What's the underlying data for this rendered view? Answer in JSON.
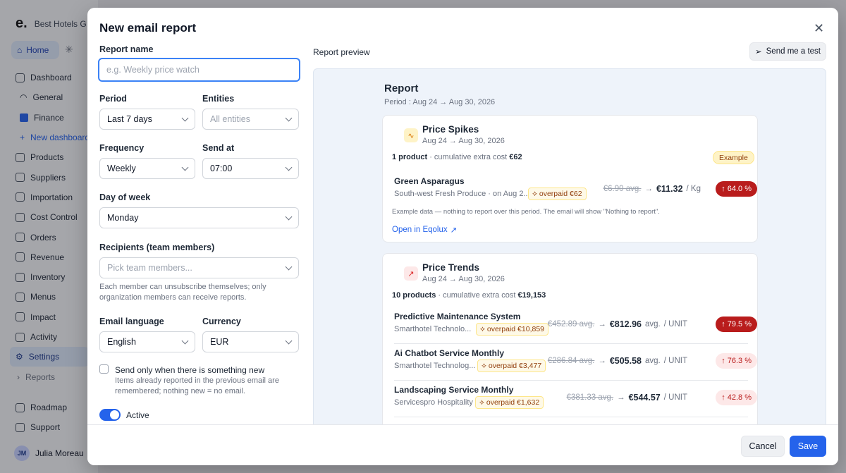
{
  "app": {
    "brand_logo": "e.",
    "brand_name": "Best Hotels G",
    "home_label": "Home",
    "nav": [
      {
        "label": "Dashboard"
      },
      {
        "label": "General"
      },
      {
        "label": "Finance"
      },
      {
        "label": "New dashboard"
      },
      {
        "label": "Products"
      },
      {
        "label": "Suppliers"
      },
      {
        "label": "Importation"
      },
      {
        "label": "Cost Control"
      },
      {
        "label": "Orders"
      },
      {
        "label": "Revenue"
      },
      {
        "label": "Inventory"
      },
      {
        "label": "Menus"
      },
      {
        "label": "Impact"
      },
      {
        "label": "Activity"
      },
      {
        "label": "Settings"
      },
      {
        "label": "Reports"
      }
    ],
    "nav_bottom": [
      {
        "label": "Roadmap"
      },
      {
        "label": "Support"
      }
    ],
    "user": {
      "initials": "JM",
      "name": "Julia Moreau"
    }
  },
  "modal": {
    "title": "New email report",
    "close_glyph": "✕",
    "form": {
      "report_name_label": "Report name",
      "report_name_placeholder": "e.g. Weekly price watch",
      "period_label": "Period",
      "period_value": "Last 7 days",
      "entities_label": "Entities",
      "entities_placeholder": "All entities",
      "frequency_label": "Frequency",
      "frequency_value": "Weekly",
      "send_at_label": "Send at",
      "send_at_value": "07:00",
      "day_label": "Day of week",
      "day_value": "Monday",
      "recipients_label": "Recipients (team members)",
      "recipients_placeholder": "Pick team members...",
      "recipients_hint_1": "Each member can unsubscribe themselves; only",
      "recipients_hint_2": "organization members can receive reports.",
      "language_label": "Email language",
      "language_value": "English",
      "currency_label": "Currency",
      "currency_value": "EUR",
      "only_new_label": "Send only when there is something new",
      "only_new_hint_1": "Items already reported in the previous email are",
      "only_new_hint_2": "remembered; nothing new = no email.",
      "active_label": "Active"
    },
    "preview": {
      "label": "Report preview",
      "send_test": "Send me a test",
      "report_title": "Report",
      "report_period": "Period : Aug 24 → Aug 30, 2026",
      "spikes": {
        "title": "Price Spikes",
        "dates": "Aug 24 → Aug 30, 2026",
        "count": "1 product",
        "sum_label": "· cumulative extra cost",
        "sum_value": "€62",
        "badge": "Example",
        "rows": [
          {
            "name": "Green Asparagus",
            "supplier": "South-west Fresh Produce · on Aug 2...",
            "overpaid": "⟡ overpaid €62",
            "old": "€6.90 avg.",
            "new": "€11.32",
            "unit": "/ Kg",
            "pct": "↑ 64.0 %"
          }
        ],
        "note": "Example data — nothing to report over this period. The email will show \"Nothing to report\".",
        "open_link": "Open in Eqolux"
      },
      "trends": {
        "title": "Price Trends",
        "dates": "Aug 24 → Aug 30, 2026",
        "count": "10 products",
        "sum_label": "· cumulative extra cost",
        "sum_value": "€19,153",
        "rows": [
          {
            "name": "Predictive Maintenance System",
            "supplier": "Smarthotel Technolo...",
            "overpaid": "⟡ overpaid €10,859",
            "old": "€452.89 avg.",
            "new": "€812.96",
            "avg": "avg.",
            "unit": "/ UNIT",
            "pct": "↑ 79.5 %"
          },
          {
            "name": "Ai Chatbot Service Monthly",
            "supplier": "Smarthotel Technolog...",
            "overpaid": "⟡ overpaid €3,477",
            "old": "€286.84 avg.",
            "new": "€505.58",
            "avg": "avg.",
            "unit": "/ UNIT",
            "pct": "↑ 76.3 %"
          },
          {
            "name": "Landscaping Service Monthly",
            "supplier": "Servicespro Hospitality",
            "overpaid": "⟡ overpaid €1,632",
            "old": "€381.33 avg.",
            "new": "€544.57",
            "avg": "avg.",
            "unit": "/ UNIT",
            "pct": "↑ 42.8 %"
          }
        ]
      }
    },
    "footer": {
      "cancel": "Cancel",
      "save": "Save"
    }
  },
  "colors": {
    "accent": "#2563eb",
    "danger": "#b91c1c",
    "warning_bg": "#fef3c7"
  }
}
